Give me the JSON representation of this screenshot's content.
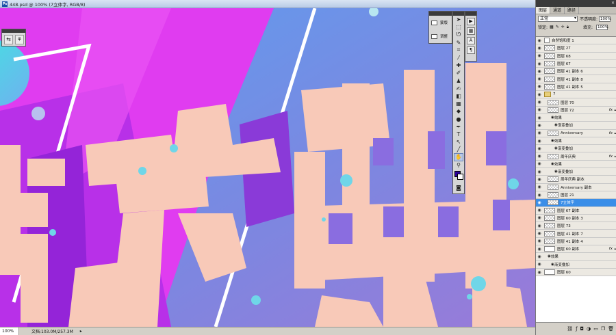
{
  "window": {
    "title": "448.psd @ 100% (7立体字, RGB/8)"
  },
  "status": {
    "zoom": "100%",
    "doc": "文档:103.0M/257.3M"
  },
  "adjustments": {
    "items": [
      {
        "label": "蒙版",
        "icon": "mask-icon"
      },
      {
        "label": "调整",
        "icon": "adjustment-icon"
      }
    ]
  },
  "tools": [
    {
      "icon": "move-icon",
      "glyph": "➤"
    },
    {
      "icon": "marquee-icon",
      "glyph": "⬚"
    },
    {
      "icon": "lasso-icon",
      "glyph": "ᘎ"
    },
    {
      "icon": "quick-select-icon",
      "glyph": "✎"
    },
    {
      "icon": "crop-icon",
      "glyph": "⌗"
    },
    {
      "icon": "eyedropper-icon",
      "glyph": "⁄"
    },
    {
      "icon": "healing-icon",
      "glyph": "✚"
    },
    {
      "icon": "brush-icon",
      "glyph": "✐"
    },
    {
      "icon": "stamp-icon",
      "glyph": "♟"
    },
    {
      "icon": "history-brush-icon",
      "glyph": "✍"
    },
    {
      "icon": "eraser-icon",
      "glyph": "◧"
    },
    {
      "icon": "gradient-icon",
      "glyph": "▦"
    },
    {
      "icon": "blur-icon",
      "glyph": "◆"
    },
    {
      "icon": "dodge-icon",
      "glyph": "●"
    },
    {
      "icon": "pen-icon",
      "glyph": "✒"
    },
    {
      "icon": "type-icon",
      "glyph": "T"
    },
    {
      "icon": "path-select-icon",
      "glyph": "↖"
    },
    {
      "icon": "shape-icon",
      "glyph": "╱"
    },
    {
      "icon": "hand-icon",
      "glyph": "✋"
    },
    {
      "icon": "zoom-icon",
      "glyph": "⚲"
    }
  ],
  "colors": {
    "foreground": "#2a0096",
    "background": "#ffffff"
  },
  "dock": [
    {
      "icon": "play-icon",
      "glyph": "▶"
    },
    {
      "icon": "swatch-grid-icon",
      "glyph": "▦"
    },
    {
      "icon": "character-icon",
      "glyph": "A"
    },
    {
      "icon": "paragraph-icon",
      "glyph": "¶"
    }
  ],
  "layers_panel": {
    "tabs": [
      "图层",
      "通道",
      "路径"
    ],
    "blend_mode": "正常",
    "opacity_label": "不透明度:",
    "opacity": "100%",
    "lock_label": "锁定:",
    "fill_label": "填充:",
    "fill": "100%",
    "layers": [
      {
        "name": "自然饱和度 1",
        "type": "adj"
      },
      {
        "name": "图层 27",
        "type": "layer"
      },
      {
        "name": "图层 68",
        "type": "layer"
      },
      {
        "name": "图层 67",
        "type": "layer"
      },
      {
        "name": "图层 41 副本 6",
        "type": "layer"
      },
      {
        "name": "图层 41 副本 8",
        "type": "layer"
      },
      {
        "name": "图层 41 副本 5",
        "type": "layer"
      },
      {
        "name": "7",
        "type": "folder"
      },
      {
        "name": "图层 70",
        "type": "layer",
        "indent": 1
      },
      {
        "name": "图层 72",
        "type": "layer",
        "indent": 1,
        "fx": "fx"
      },
      {
        "name": "效果",
        "type": "effect",
        "indent": 2
      },
      {
        "name": "渐变叠加",
        "type": "effect",
        "indent": 3
      },
      {
        "name": "Anniversary",
        "type": "layer",
        "indent": 1,
        "fx": "fx"
      },
      {
        "name": "效果",
        "type": "effect",
        "indent": 2
      },
      {
        "name": "渐变叠加",
        "type": "effect",
        "indent": 3
      },
      {
        "name": "周年庆典",
        "type": "layer",
        "indent": 1,
        "fx": "fx"
      },
      {
        "name": "效果",
        "type": "effect",
        "indent": 2
      },
      {
        "name": "渐变叠加",
        "type": "effect",
        "indent": 3
      },
      {
        "name": "周年庆典 副本",
        "type": "layer",
        "indent": 1
      },
      {
        "name": "Anniversary 副本",
        "type": "layer",
        "indent": 1
      },
      {
        "name": "图层 21",
        "type": "layer",
        "indent": 1
      },
      {
        "name": "7立体字",
        "type": "layer",
        "indent": 1,
        "selected": true
      },
      {
        "name": "图层 67 副本",
        "type": "layer"
      },
      {
        "name": "图层 60 副本 3",
        "type": "layer"
      },
      {
        "name": "图层 73",
        "type": "layer"
      },
      {
        "name": "图层 41 副本 7",
        "type": "layer"
      },
      {
        "name": "图层 41 副本 4",
        "type": "layer"
      },
      {
        "name": "图层 60 副本",
        "type": "white",
        "fx": "fx"
      },
      {
        "name": "效果",
        "type": "effect",
        "indent": 1
      },
      {
        "name": "渐变叠加",
        "type": "effect",
        "indent": 2
      },
      {
        "name": "图层 60",
        "type": "white"
      }
    ]
  }
}
